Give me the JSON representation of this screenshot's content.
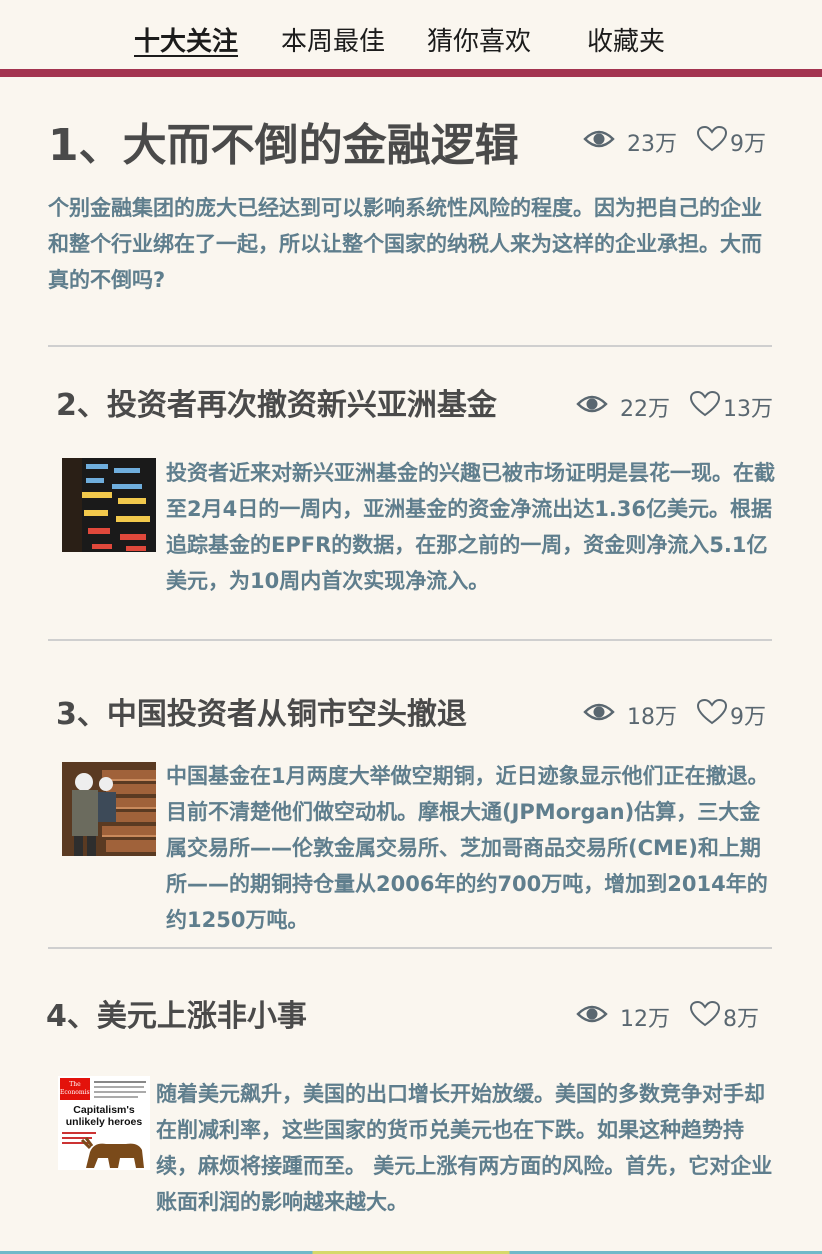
{
  "tabs": [
    {
      "label": "十大关注",
      "active": true
    },
    {
      "label": "本周最佳",
      "active": false
    },
    {
      "label": "猜你喜欢",
      "active": false
    },
    {
      "label": "收藏夹",
      "active": false
    }
  ],
  "colors": {
    "accent": "#a33450",
    "title": "#4a4a4a",
    "summary": "#5f7e8d",
    "stats": "#5a6770",
    "background": "#faf6ef"
  },
  "icons": {
    "views": "eye-icon",
    "likes": "heart-outline-icon"
  },
  "articles": [
    {
      "title": "1、大而不倒的金融逻辑",
      "views": "23万",
      "likes": "9万",
      "summary": "个别金融集团的庞大已经达到可以影响系统性风险的程度。因为把自己的企业和整个行业绑在了一起，所以让整个国家的纳税人来为这样的企业承担。大而真的不倒吗?"
    },
    {
      "title": "2、投资者再次撤资新兴亚洲基金",
      "views": "22万",
      "likes": "13万",
      "thumbnail": "stock-ticker-board-image",
      "summary": "投资者近来对新兴亚洲基金的兴趣已被市场证明是昙花一现。在截至2月4日的一周内，亚洲基金的资金净流出达1.36亿美元。根据追踪基金的EPFR的数据，在那之前的一周，资金则净流入5.1亿美元，为10周内首次实现净流入。"
    },
    {
      "title": "3、中国投资者从铜市空头撤退",
      "views": "18万",
      "likes": "9万",
      "thumbnail": "copper-workers-image",
      "summary": "中国基金在1月两度大举做空期铜，近日迹象显示他们正在撤退。目前不清楚他们做空动机。摩根大通(JPMorgan)估算，三大金属交易所——伦敦金属交易所、芝加哥商品交易所(CME)和上期所——的期铜持仓量从2006年的约700万吨，增加到2014年的约1250万吨。"
    },
    {
      "title": "4、美元上涨非小事",
      "views": "12万",
      "likes": "8万",
      "thumbnail": "economist-cover-image",
      "thumbnail_text": {
        "masthead": "The Economist",
        "headline": "Capitalism's unlikely heroes"
      },
      "summary": "随着美元飙升，美国的出口增长开始放缓。美国的多数竞争对手却在削减利率，这些国家的货币兑美元也在下跌。如果这种趋势持续，麻烦将接踵而至。 美元上涨有两方面的风险。首先，它对企业账面利润的影响越来越大。"
    }
  ]
}
